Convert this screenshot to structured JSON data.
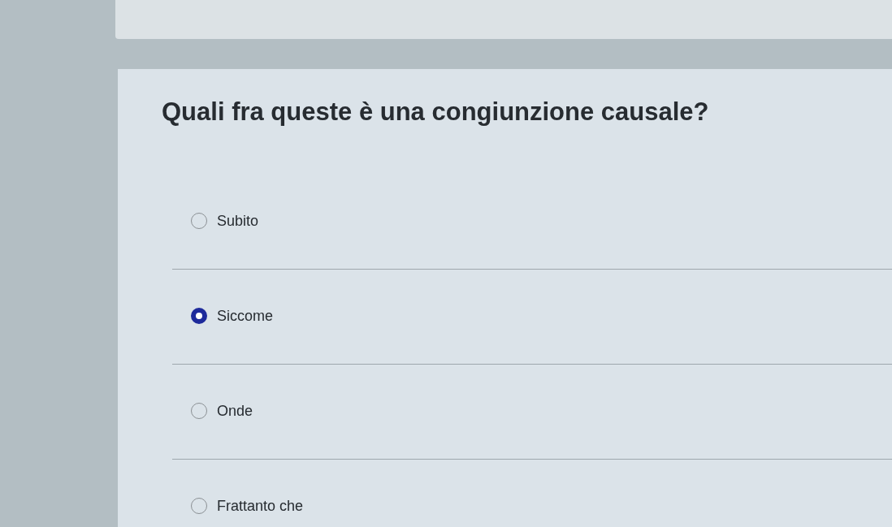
{
  "question": "Quali fra queste è una congiunzione causale?",
  "options": [
    {
      "label": "Subito",
      "selected": false
    },
    {
      "label": "Siccome",
      "selected": true
    },
    {
      "label": "Onde",
      "selected": false
    },
    {
      "label": "Frattanto che",
      "selected": false
    }
  ]
}
